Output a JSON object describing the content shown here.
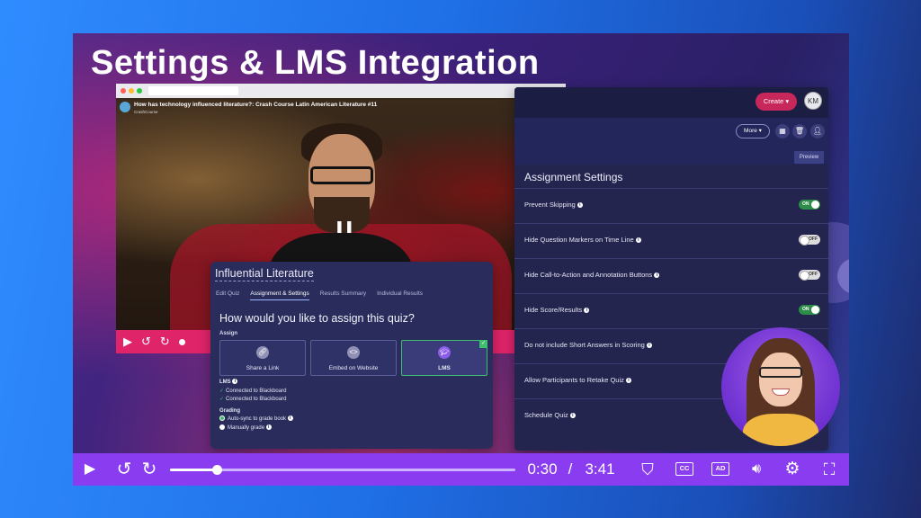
{
  "slide_title": "Settings & LMS Integration",
  "video": {
    "title": "How has technology influenced literature?: Crash Course Latin American Literature #11",
    "channel": "CrashCourse"
  },
  "quiz": {
    "title": "Influential Literature",
    "tabs": [
      {
        "label": "Edit Quiz",
        "active": false
      },
      {
        "label": "Assignment & Settings",
        "active": true
      },
      {
        "label": "Results Summary",
        "active": false
      },
      {
        "label": "Individual Results",
        "active": false
      }
    ],
    "question": "How would you like to assign this quiz?",
    "assign_label": "Assign",
    "assign_options": [
      {
        "label": "Share a Link",
        "icon": "link-icon",
        "selected": false
      },
      {
        "label": "Embed on Website",
        "icon": "embed-icon",
        "selected": false
      },
      {
        "label": "LMS",
        "icon": "graduation-cap-icon",
        "selected": true
      }
    ],
    "lms_header": "LMS",
    "lms_status": [
      "Connected to Blackboard",
      "Connected to Blackboard"
    ],
    "grading_header": "Grading",
    "grading_options": [
      {
        "label": "Auto-sync to grade book",
        "selected": true
      },
      {
        "label": "Manually grade",
        "selected": false
      }
    ]
  },
  "settings": {
    "create_label": "Create",
    "avatar_initials": "KM",
    "more_label": "More",
    "preview_label": "Preview",
    "header": "Assignment Settings",
    "rows": [
      {
        "label": "Prevent Skipping",
        "toggle": "ON"
      },
      {
        "label": "Hide Question Markers on Time Line",
        "toggle": "OFF"
      },
      {
        "label": "Hide Call-to-Action and Annotation Buttons",
        "toggle": "OFF"
      },
      {
        "label": "Hide Score/Results",
        "toggle": "ON"
      },
      {
        "label": "Do not include Short Answers in Scoring",
        "toggle": ""
      },
      {
        "label": "Allow Participants to Retake Quiz",
        "toggle": ""
      },
      {
        "label": "Schedule Quiz",
        "toggle": ""
      }
    ]
  },
  "player": {
    "current_time": "0:30",
    "separator": "/",
    "duration": "3:41",
    "progress_fraction": 0.136,
    "cc_label": "CC",
    "ad_label": "AD"
  },
  "colors": {
    "accent_purple": "#8a3cf0",
    "accent_pink": "#e0246a",
    "create_red": "#c8275c",
    "toggle_green": "#2e8c4a",
    "panel_navy": "#24254f"
  }
}
